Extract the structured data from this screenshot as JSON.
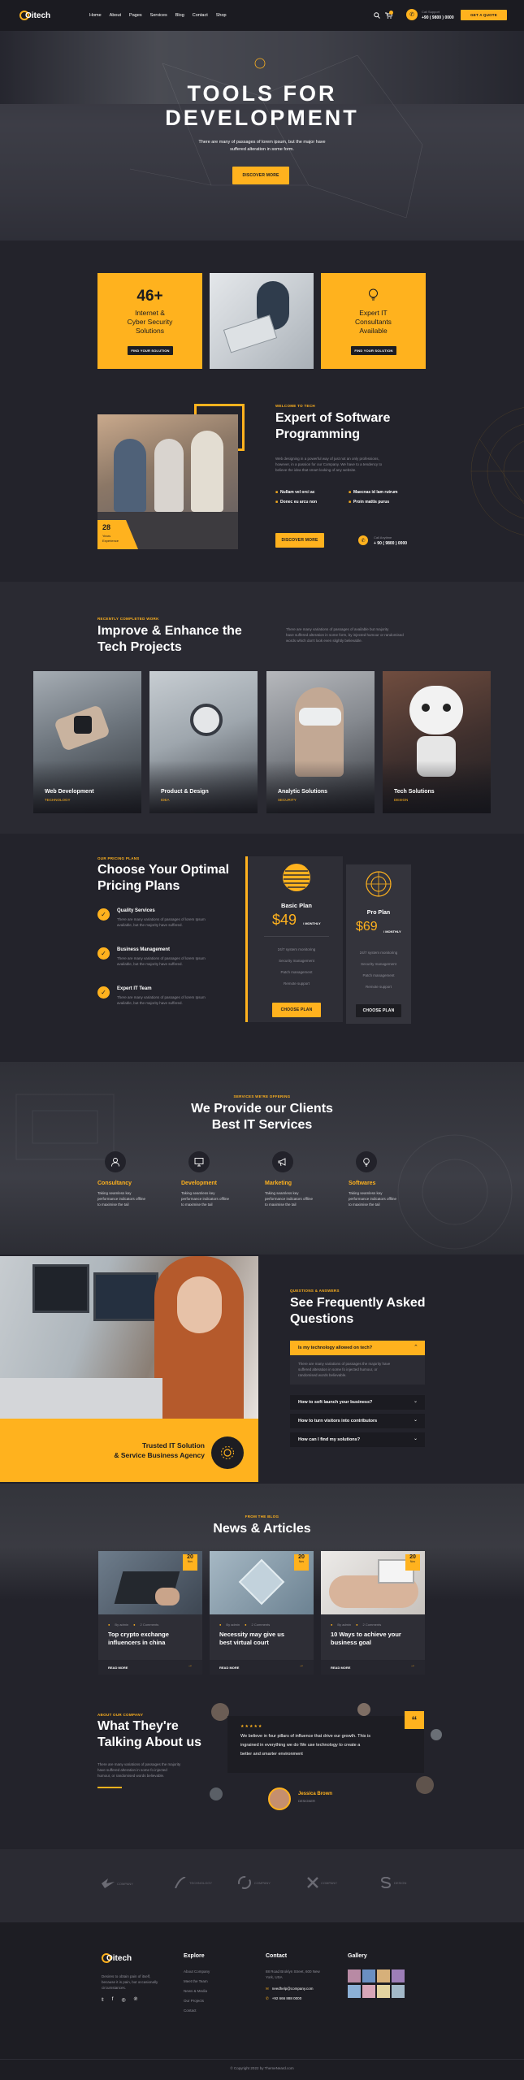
{
  "nav": {
    "logo": "Oitech",
    "links": [
      "Home",
      "About",
      "Pages",
      "Services",
      "Blog",
      "Contact",
      "Shop"
    ],
    "support_label": "Call Support",
    "phone": "+90 ( 9800 ) 0000",
    "cta": "GET A QUOTE"
  },
  "hero": {
    "title_line1": "TOOLS FOR",
    "title_line2": "DEVELOPMENT",
    "text_line1": "There are many of passages of lorem ipsum, but the major have",
    "text_line2": "suffered alteration in some form.",
    "button": "DISCOVER MORE"
  },
  "stats": [
    {
      "number": "46+",
      "line1": "Internet &",
      "line2": "Cyber Security",
      "line3": "Solutions",
      "button": "FIND YOUR SOLUTION"
    },
    {
      "number": "",
      "line1": "Expert IT",
      "line2": "Consultants",
      "line3": "Available",
      "button": "FIND YOUR SOLUTION"
    }
  ],
  "about": {
    "tag": "WELCOME TO TECH",
    "title_line1": "Expert of Software",
    "title_line2": "Programming",
    "text_line1": "Web designing in a powerful way of just not an only professions,",
    "text_line2": "however, in a passion for our Company. We have to a tendency to",
    "text_line3": "believe the idea that smart looking of any website.",
    "badge_number": "28",
    "badge_line1": "Years",
    "badge_line2": "Experience",
    "checks": [
      "Nullam vel orci ac",
      "Maecnas id lam rutrum",
      "Donec eu arcu non",
      "Proin mattis purus"
    ],
    "button": "DISCOVER MORE",
    "call_label": "Call Anytime",
    "phone": "+ 90 ( 9800 ) 0000"
  },
  "projects": {
    "tag": "RECENTLY COMPLETED WORK",
    "title_line1": "Improve & Enhance the",
    "title_line2": "Tech Projects",
    "text_line1": "There are many variations of passages of available but majority",
    "text_line2": "have suffered alteration in some form, by injected humour or randomised",
    "text_line3": "words which don't look even slightly believable.",
    "items": [
      {
        "title": "Web Development",
        "category": "TECHNOLOGY"
      },
      {
        "title": "Product & Design",
        "category": "IDEA"
      },
      {
        "title": "Analytic Solutions",
        "category": "SECURITY"
      },
      {
        "title": "Tech Solutions",
        "category": "DESIGN"
      }
    ]
  },
  "pricing": {
    "tag": "OUR PRICING PLANS",
    "title_line1": "Choose Your Optimal",
    "title_line2": "Pricing Plans",
    "features": [
      {
        "title": "Quality Services",
        "line1": "There are many variations of passages of lorem Ipsum",
        "line2": "available, but the majority have suffered."
      },
      {
        "title": "Business Management",
        "line1": "There are many variations of passages of lorem Ipsum",
        "line2": "available, but the majority have suffered."
      },
      {
        "title": "Expert IT Team",
        "line1": "There are many variations of passages of lorem Ipsum",
        "line2": "available, but the majority have suffered."
      }
    ],
    "plans": [
      {
        "name": "Basic Plan",
        "price": "$49",
        "period": "/ MONTHLY",
        "items": [
          "24/7 system monitoring",
          "Security management",
          "Patch management",
          "Remote support"
        ],
        "button": "CHOOSE PLAN"
      },
      {
        "name": "Pro Plan",
        "price": "$69",
        "period": "/ MONTHLY",
        "items": [
          "24/7 system monitoring",
          "Security management",
          "Patch management",
          "Remote support"
        ],
        "button": "CHOOSE PLAN"
      }
    ]
  },
  "services": {
    "tag": "SERVICES WE'RE OFFERING",
    "title_line1": "We Provide our Clients",
    "title_line2": "Best IT Services",
    "items": [
      {
        "title": "Consultancy",
        "line1": "Taking seamless key",
        "line2": "performance indicators offline",
        "line3": "to maximise the tail"
      },
      {
        "title": "Development",
        "line1": "Taking seamless key",
        "line2": "performance indicators offline",
        "line3": "to maximise the tail"
      },
      {
        "title": "Marketing",
        "line1": "Taking seamless key",
        "line2": "performance indicators offline",
        "line3": "to maximise the tail"
      },
      {
        "title": "Softwares",
        "line1": "Taking seamless key",
        "line2": "performance indicators offline",
        "line3": "to maximise the tail"
      }
    ]
  },
  "faq": {
    "tag": "QUESTIONS & ANSWERS",
    "title_line1": "See Frequently Asked",
    "title_line2": "Questions",
    "banner_line1": "Trusted IT Solution",
    "banner_line2": "& Service Business Agency",
    "items": [
      {
        "q": "Is my technology allowed on tech?",
        "a_line1": "There are many variations of passages the majority have",
        "a_line2": "suffered alteration in some fo injected humour, or",
        "a_line3": "randomised words believable."
      },
      {
        "q": "How to soft launch your business?"
      },
      {
        "q": "How to turn visitors into contributors"
      },
      {
        "q": "How can I find my solutions?"
      }
    ]
  },
  "news": {
    "tag": "FROM THE BLOG",
    "title": "News & Articles",
    "posts": [
      {
        "day": "20",
        "month": "Nov",
        "author": "By admin",
        "comments": "2 Comments",
        "title_line1": "Top crypto exchange",
        "title_line2": "influencers in china",
        "read": "READ MORE"
      },
      {
        "day": "20",
        "month": "Nov",
        "author": "By admin",
        "comments": "2 Comments",
        "title_line1": "Necessity may give us",
        "title_line2": "best virtual court",
        "read": "READ MORE"
      },
      {
        "day": "20",
        "month": "Nov",
        "author": "By admin",
        "comments": "2 Comments",
        "title_line1": "10 Ways to achieve your",
        "title_line2": "business goal",
        "read": "READ MORE"
      }
    ]
  },
  "testimonial": {
    "tag": "ABOUT OUR COMPANY",
    "title_line1": "What They're",
    "title_line2": "Talking About us",
    "text_line1": "There are many variations of passages the majority",
    "text_line2": "have suffered alteration in some fo injected",
    "text_line3": "humour, or randomised words believable.",
    "quote_line1": "We believe in four pillars of influence that drive our growth. This is",
    "quote_line2": "ingrained in everything we do We use technology to create a",
    "quote_line3": "better and smarter environment",
    "name": "Jessica Brown",
    "role": "DESIGNER"
  },
  "partners": [
    "COMPANY",
    "TECHNOLOGY",
    "COMPANY",
    "COMPANY",
    "DESIGN"
  ],
  "footer": {
    "logo": "Oitech",
    "about_line1": "Desires to obtain pain of itself,",
    "about_line2": "because it is pain, but occasionally",
    "about_line3": "circumstances.",
    "explore_title": "Explore",
    "explore": [
      "About Company",
      "Meet the Team",
      "News & Media",
      "Our Projects",
      "Contact"
    ],
    "contact_title": "Contact",
    "address_line1": "88 Road Broklyn Street, 600 New",
    "address_line2": "York, USA",
    "email": "needhelp@company.com",
    "phone": "+92 666 888 0000",
    "gallery_title": "Gallery",
    "copyright": "© Copyright 2022 by ThemeNeard.com"
  },
  "colors": {
    "accent": "#ffb21e",
    "bg": "#23232b",
    "dark": "#1b1b21"
  }
}
